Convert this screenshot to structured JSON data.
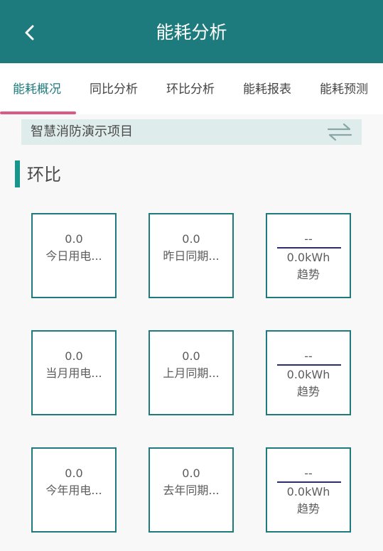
{
  "header": {
    "title": "能耗分析",
    "back_icon": "chevron-left-icon"
  },
  "tabs": [
    {
      "label": "能耗概况",
      "active": true
    },
    {
      "label": "同比分析",
      "active": false
    },
    {
      "label": "环比分析",
      "active": false
    },
    {
      "label": "能耗报表",
      "active": false
    },
    {
      "label": "能耗预测",
      "active": false
    }
  ],
  "project": {
    "name": "智慧消防演示项目",
    "switch_icon": "swap-arrows-icon"
  },
  "section": {
    "title": "环比"
  },
  "rows": [
    {
      "current": {
        "value": "0.0",
        "label": "今日用电..."
      },
      "previous": {
        "value": "0.0",
        "label": "昨日同期..."
      },
      "trend": {
        "change": "--",
        "unit_value": "0.0kWh",
        "label": "趋势"
      }
    },
    {
      "current": {
        "value": "0.0",
        "label": "当月用电..."
      },
      "previous": {
        "value": "0.0",
        "label": "上月同期..."
      },
      "trend": {
        "change": "--",
        "unit_value": "0.0kWh",
        "label": "趋势"
      }
    },
    {
      "current": {
        "value": "0.0",
        "label": "今年用电..."
      },
      "previous": {
        "value": "0.0",
        "label": "去年同期..."
      },
      "trend": {
        "change": "--",
        "unit_value": "0.0kWh",
        "label": "趋势"
      }
    }
  ],
  "colors": {
    "primary": "#1e7b7d",
    "tab_indicator": "#d95a86",
    "section_accent": "#16968c",
    "project_bar": "#dfecec"
  }
}
